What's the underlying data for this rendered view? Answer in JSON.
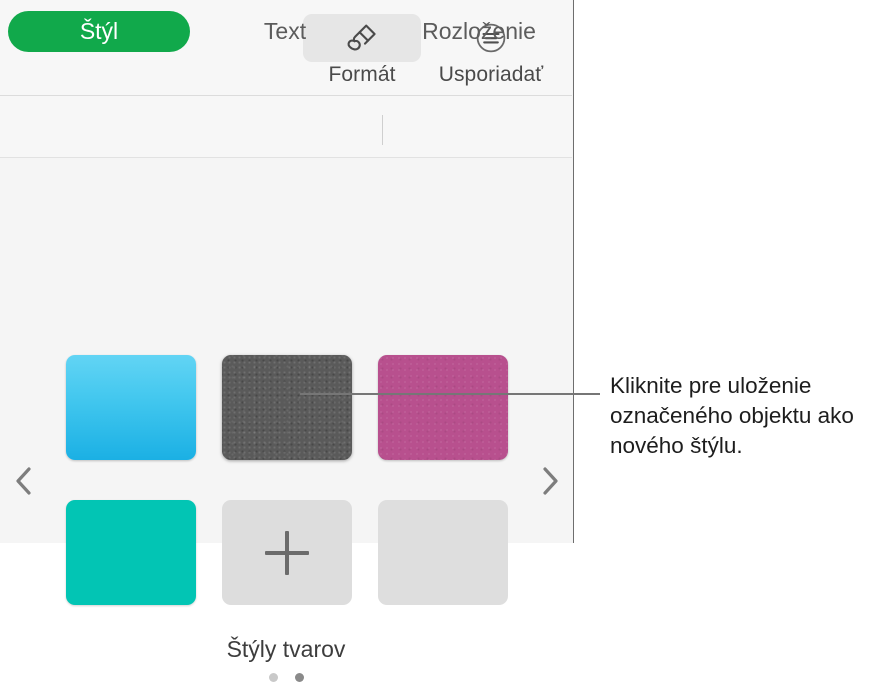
{
  "panel": {
    "toolbar": {
      "buttons": [
        {
          "label": "Formát",
          "icon": "paintbrush-icon",
          "active": true
        },
        {
          "label": "Usporiadať",
          "icon": "arrange-align-icon",
          "active": false
        }
      ]
    },
    "tabs": [
      {
        "label": "Štýl",
        "selected": true
      },
      {
        "label": "Text",
        "selected": false
      },
      {
        "label": "Rozloženie",
        "selected": false
      }
    ],
    "nav": {
      "prev_icon": "chevron-left-icon",
      "next_icon": "chevron-right-icon"
    },
    "shape_styles": {
      "caption": "Štýly tvarov",
      "rows": [
        [
          {
            "name": "style-blue-gradient",
            "kind": "swatch",
            "color": "#44c8ef"
          },
          {
            "name": "style-gray-texture",
            "kind": "swatch",
            "color": "#5a5a5a"
          },
          {
            "name": "style-pink",
            "kind": "swatch",
            "color": "#b8508e"
          }
        ],
        [
          {
            "name": "style-teal",
            "kind": "swatch",
            "color": "#02c5b4"
          },
          {
            "name": "style-add-new",
            "kind": "add",
            "icon": "plus-icon",
            "color": "#dddddd"
          },
          {
            "name": "style-empty-slot",
            "kind": "empty",
            "color": "#dedede"
          }
        ]
      ],
      "page_dots": [
        {
          "active": false
        },
        {
          "active": true
        }
      ]
    }
  },
  "callout": {
    "text": "Kliknite pre uloženie označeného objektu ako nového štýlu.",
    "line_color": "#767676"
  },
  "theme": {
    "accent_green": "#11a94b",
    "panel_bg": "#f5f5f5",
    "toolbar_bg": "#f7f7f7",
    "text_color": "#4a4a4a"
  }
}
